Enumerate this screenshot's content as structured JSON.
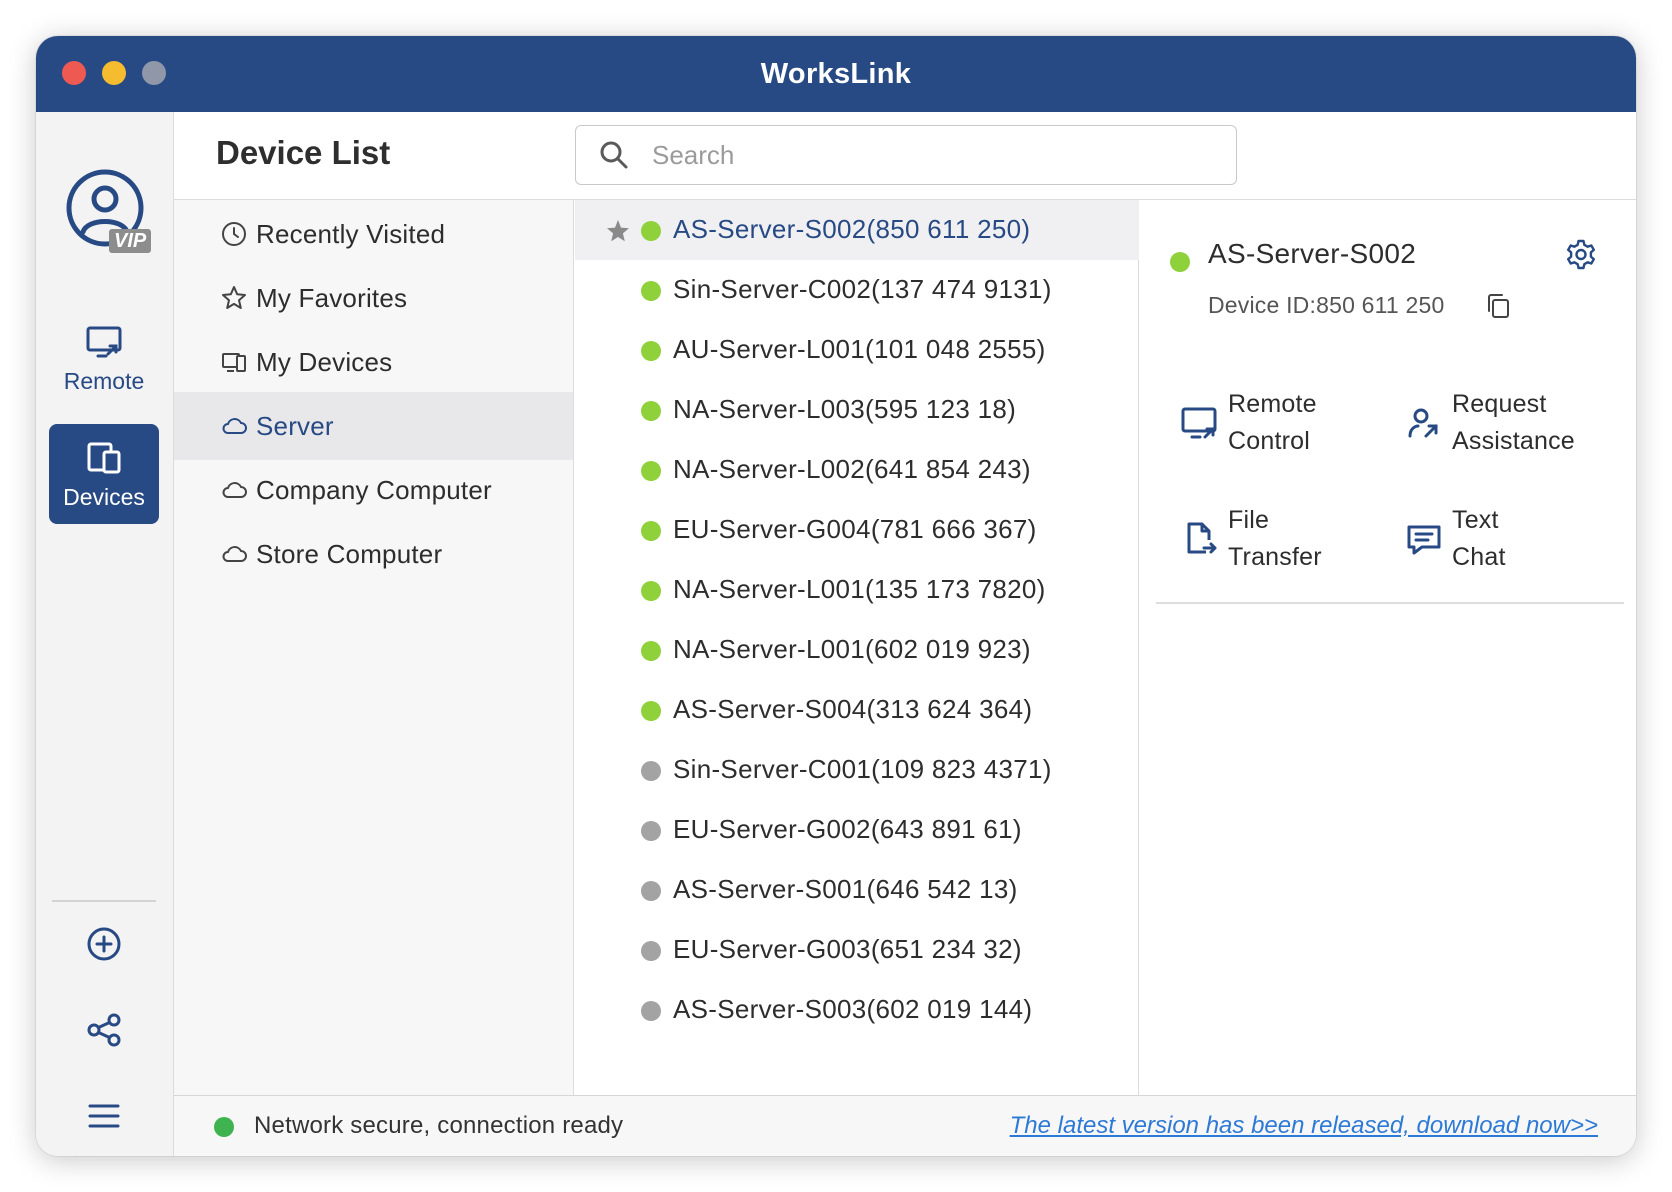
{
  "window": {
    "title": "WorksLink"
  },
  "colors": {
    "brand": "#284a84",
    "online": "#8fd13a",
    "offline": "#a3a3a3",
    "status_ok": "#3fb34f",
    "link": "#2d7ad6"
  },
  "sidebar": {
    "vip_badge": "VIP",
    "remote_label": "Remote",
    "devices_label": "Devices",
    "icons": [
      "user-avatar-icon",
      "remote-monitor-icon",
      "devices-icon",
      "add-circle-icon",
      "share-icon",
      "menu-icon"
    ]
  },
  "header": {
    "title": "Device List",
    "search_placeholder": "Search"
  },
  "categories": [
    {
      "label": "Recently Visited",
      "icon": "clock-icon",
      "active": false
    },
    {
      "label": "My Favorites",
      "icon": "star-icon",
      "active": false
    },
    {
      "label": "My Devices",
      "icon": "devices-icon",
      "active": false
    },
    {
      "label": "Server",
      "icon": "cloud-icon",
      "active": true
    },
    {
      "label": "Company Computer",
      "icon": "cloud-icon",
      "active": false
    },
    {
      "label": "Store Computer",
      "icon": "cloud-icon",
      "active": false
    }
  ],
  "devices": [
    {
      "label": "AS-Server-S002(850 611 250)",
      "online": true,
      "favorite": true,
      "selected": true
    },
    {
      "label": "Sin-Server-C002(137 474 9131)",
      "online": true
    },
    {
      "label": "AU-Server-L001(101 048 2555)",
      "online": true
    },
    {
      "label": "NA-Server-L003(595 123 18)",
      "online": true
    },
    {
      "label": "NA-Server-L002(641 854 243)",
      "online": true
    },
    {
      "label": "EU-Server-G004(781 666 367)",
      "online": true
    },
    {
      "label": "NA-Server-L001(135 173 7820)",
      "online": true
    },
    {
      "label": "NA-Server-L001(602 019 923)",
      "online": true
    },
    {
      "label": "AS-Server-S004(313 624 364)",
      "online": true
    },
    {
      "label": "Sin-Server-C001(109 823 4371)",
      "online": false
    },
    {
      "label": "EU-Server-G002(643 891 61)",
      "online": false
    },
    {
      "label": "AS-Server-S001(646 542 13)",
      "online": false
    },
    {
      "label": "EU-Server-G003(651 234 32)",
      "online": false
    },
    {
      "label": "AS-Server-S003(602 019 144)",
      "online": false
    }
  ],
  "detail": {
    "name": "AS-Server-S002",
    "device_id": "Device ID:850 611 250",
    "actions": [
      {
        "label": "Remote\nControl",
        "icon": "remote-control-icon"
      },
      {
        "label": "Request\nAssistance",
        "icon": "request-assistance-icon"
      },
      {
        "label": "File\nTransfer",
        "icon": "file-transfer-icon"
      },
      {
        "label": "Text\nChat",
        "icon": "text-chat-icon"
      }
    ]
  },
  "status": {
    "text": "Network secure, connection ready",
    "update_link": "The latest version has been released, download now>>"
  }
}
